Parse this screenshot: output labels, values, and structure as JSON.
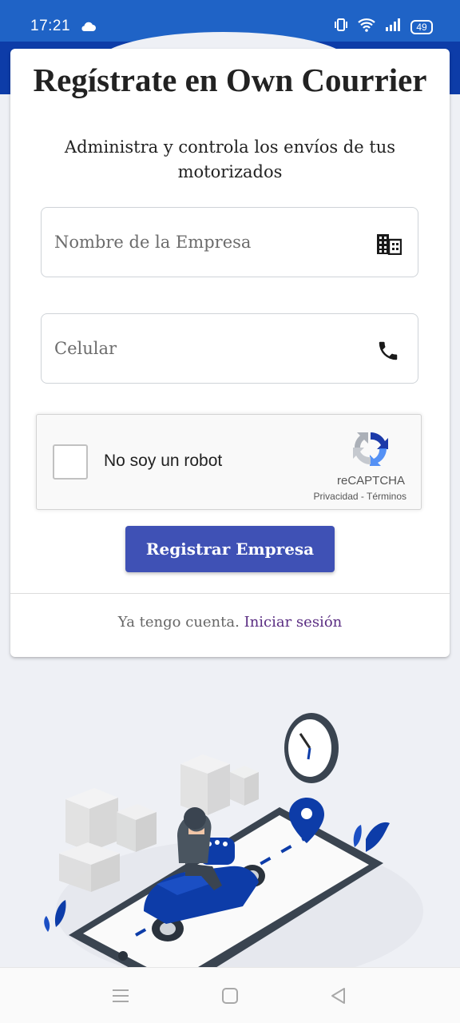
{
  "status_bar": {
    "time": "17:21",
    "battery": "49",
    "icons": [
      "cloud-icon",
      "vibrate-icon",
      "wifi-icon",
      "signal-icon",
      "battery-icon"
    ]
  },
  "form": {
    "title": "Regístrate en Own Courrier",
    "subtitle": "Administra y controla los envíos de tus motorizados",
    "company_field": {
      "placeholder": "Nombre de la Empresa",
      "value": "",
      "icon": "business-icon"
    },
    "phone_field": {
      "placeholder": "Celular",
      "value": "",
      "icon": "phone-icon"
    },
    "captcha": {
      "label": "No soy un robot",
      "brand": "reCAPTCHA",
      "links": "Privacidad - Términos",
      "checked": false
    },
    "submit_label": "Registrar Empresa",
    "login_prompt": "Ya tengo cuenta.",
    "login_link": "Iniciar sesión"
  },
  "colors": {
    "status_bar": "#1f63c6",
    "primary_button": "#3f51b5",
    "login_link": "#5a2d82",
    "illustration_blue": "#0d3ca8"
  },
  "nav_bar": {
    "buttons": [
      "menu-icon",
      "home-square-icon",
      "back-triangle-icon"
    ]
  }
}
